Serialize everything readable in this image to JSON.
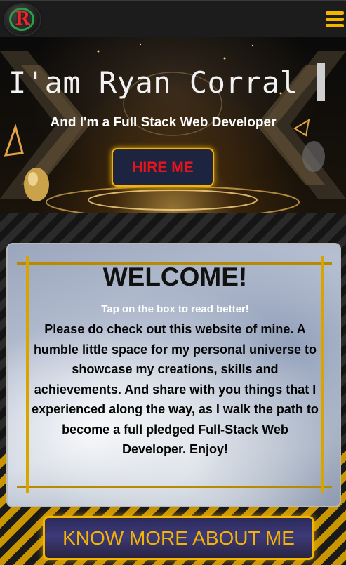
{
  "header": {
    "logo_letter": "R",
    "menu_icon": "hamburger-menu-icon"
  },
  "hero": {
    "title": "I'am Ryan Corral",
    "subtitle": "And I'm a Full Stack Web Developer",
    "hire_label": "HIRE ME"
  },
  "welcome": {
    "title": "WELCOME!",
    "hint": "Tap on the box to read better!",
    "body": "Please do check out this website of mine. A humble little space for my personal universe to showcase my creations, skills and achievements. And share with you things that I experienced along the way, as I walk the path to become a full pledged Full-Stack Web Developer. Enjoy!"
  },
  "cta": {
    "label": "KNOW MORE ABOUT ME"
  },
  "colors": {
    "accent": "#f5b400",
    "hire_text": "#e8141c",
    "topbar": "#1c1c1c"
  }
}
